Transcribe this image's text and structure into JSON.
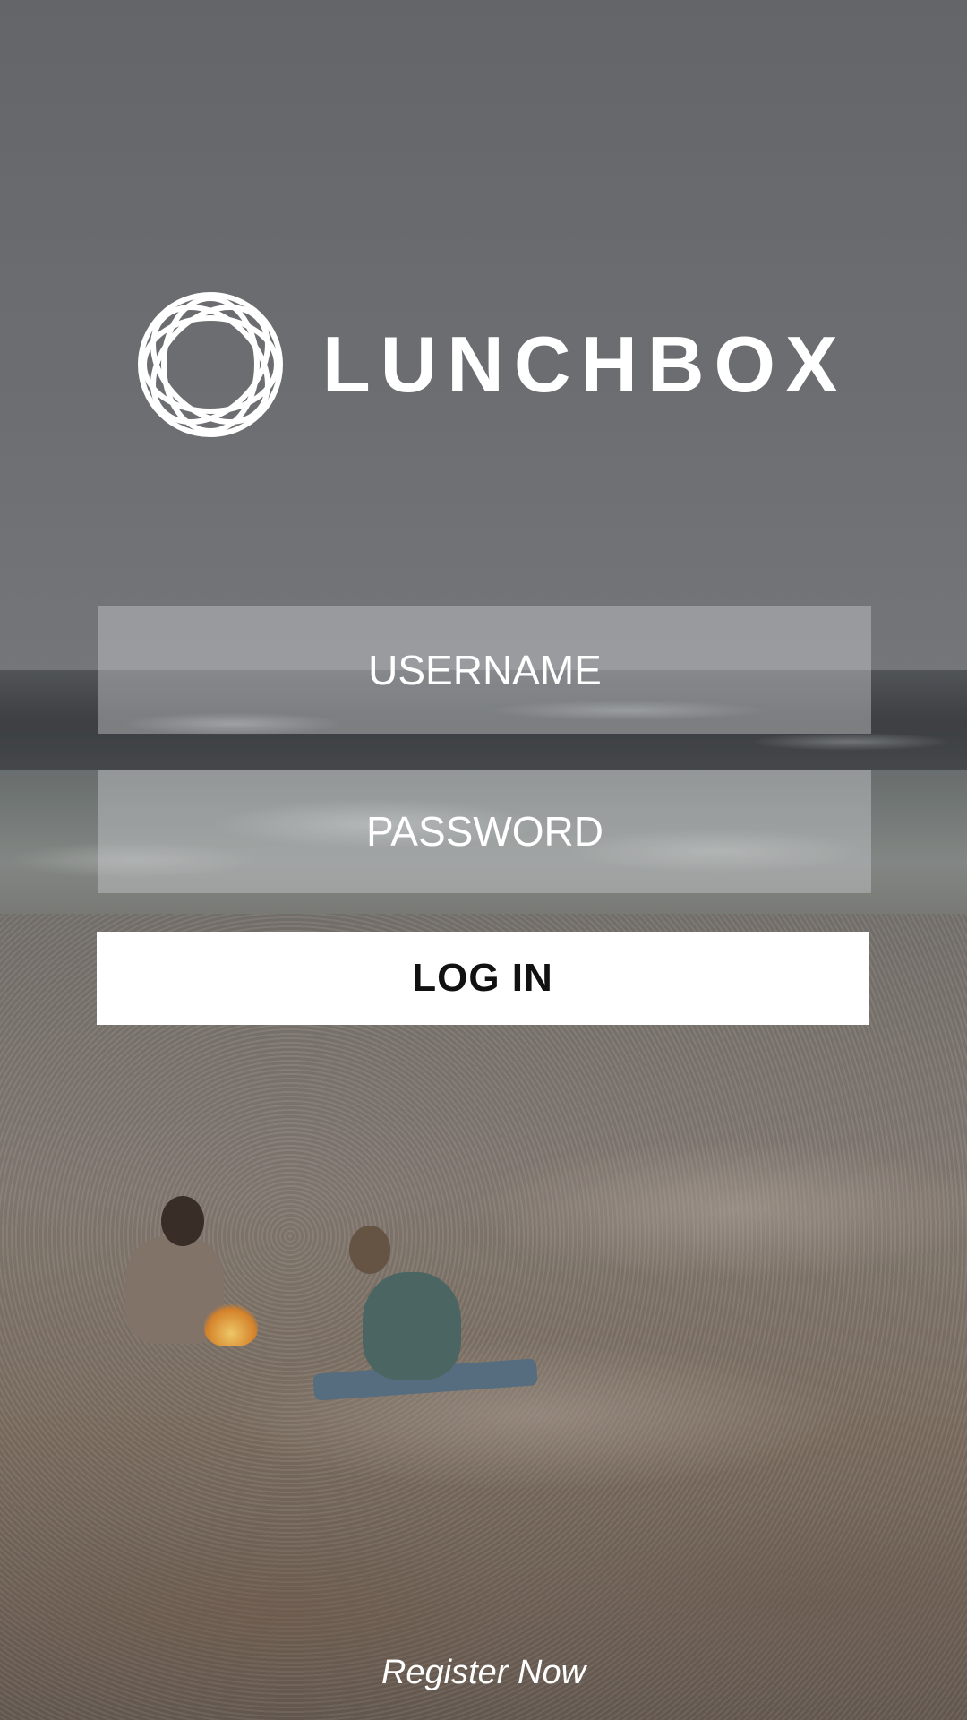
{
  "app": {
    "brand_name": "LUNCHBOX",
    "logo_icon": "interlaced-rings-logo-icon"
  },
  "login_form": {
    "username_placeholder": "USERNAME",
    "password_placeholder": "PASSWORD",
    "login_button_label": "LOG IN"
  },
  "footer": {
    "register_link_label": "Register Now"
  },
  "colors": {
    "text": "#ffffff",
    "button_background": "#ffffff",
    "button_text": "#111111",
    "field_background": "rgba(200,202,205,0.45)"
  }
}
